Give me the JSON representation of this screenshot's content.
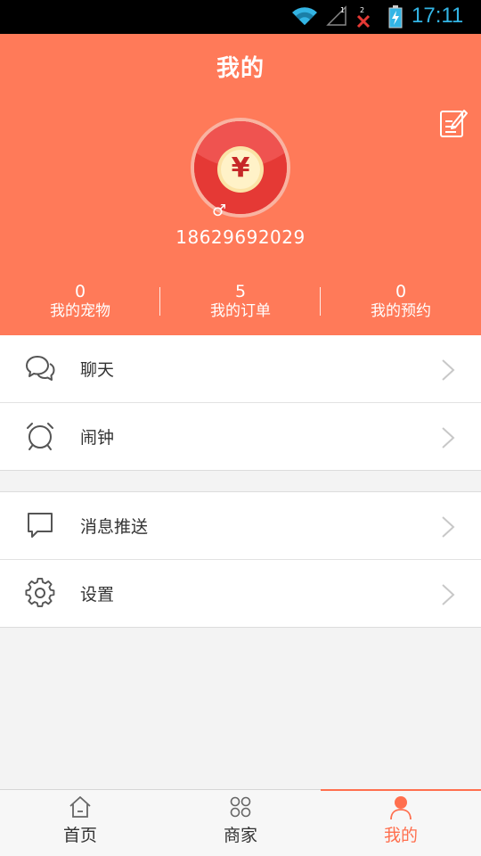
{
  "status_bar": {
    "time": "17:11",
    "signal_1_label": "1",
    "signal_2_label": "2"
  },
  "header": {
    "title": "我的",
    "edit_icon": "edit-icon"
  },
  "profile": {
    "avatar_icon": "red-envelope-yuan-icon",
    "avatar_symbol": "¥",
    "gender_symbol": "♂",
    "phone": "18629692029"
  },
  "stats": [
    {
      "value": "0",
      "label": "我的宠物"
    },
    {
      "value": "5",
      "label": "我的订单"
    },
    {
      "value": "0",
      "label": "我的预约"
    }
  ],
  "menu_group_1": [
    {
      "label": "聊天",
      "icon": "chat-icon"
    },
    {
      "label": "闹钟",
      "icon": "alarm-clock-icon"
    }
  ],
  "menu_group_2": [
    {
      "label": "消息推送",
      "icon": "message-icon"
    },
    {
      "label": "设置",
      "icon": "gear-icon"
    }
  ],
  "bottom_nav": [
    {
      "label": "首页",
      "icon": "home-icon",
      "active": false
    },
    {
      "label": "商家",
      "icon": "grid-icon",
      "active": false
    },
    {
      "label": "我的",
      "icon": "person-icon",
      "active": true
    }
  ],
  "colors": {
    "primary": "#ff7a59",
    "active_tab": "#ff6f4e",
    "status_accent": "#33b5e5",
    "background": "#f3f3f3"
  }
}
